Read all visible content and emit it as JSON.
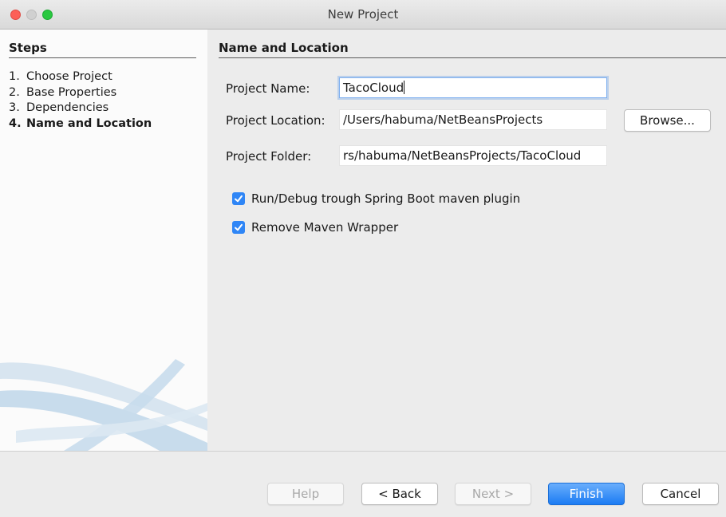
{
  "window": {
    "title": "New Project"
  },
  "steps": {
    "heading": "Steps",
    "items": [
      {
        "num": "1.",
        "label": "Choose Project"
      },
      {
        "num": "2.",
        "label": "Base Properties"
      },
      {
        "num": "3.",
        "label": "Dependencies"
      },
      {
        "num": "4.",
        "label": "Name and Location"
      }
    ],
    "active_index": 3
  },
  "main": {
    "heading": "Name and Location",
    "project_name": {
      "label": "Project Name:",
      "value": "TacoCloud"
    },
    "project_location": {
      "label": "Project Location:",
      "value": "/Users/habuma/NetBeansProjects",
      "browse_label": "Browse..."
    },
    "project_folder": {
      "label": "Project Folder:",
      "value": "rs/habuma/NetBeansProjects/TacoCloud"
    },
    "checkboxes": [
      {
        "label": "Run/Debug trough Spring Boot maven plugin",
        "checked": true
      },
      {
        "label": "Remove Maven Wrapper",
        "checked": true
      }
    ]
  },
  "buttons": {
    "help": "Help",
    "back": "< Back",
    "next": "Next >",
    "finish": "Finish",
    "cancel": "Cancel"
  },
  "colors": {
    "accent": "#2f86f6",
    "close": "#fc5f57",
    "zoom": "#29c840"
  }
}
